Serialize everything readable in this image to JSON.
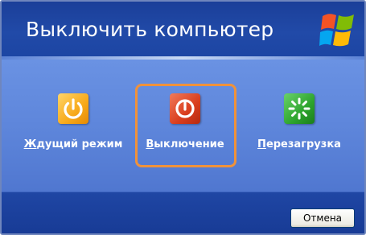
{
  "dialog": {
    "title": "Выключить компьютер"
  },
  "options": [
    {
      "label_first": "Ж",
      "label_rest": "дущий режим",
      "icon": "standby-icon"
    },
    {
      "label_first": "В",
      "label_rest": "ыключение",
      "icon": "power-icon"
    },
    {
      "label_first": "П",
      "label_rest": "ерезагрузка",
      "icon": "restart-icon"
    }
  ],
  "footer": {
    "cancel_label": "Отмена"
  },
  "colors": {
    "header": "#1b3f99",
    "body": "#5e86db",
    "highlight": "#f0923a"
  }
}
